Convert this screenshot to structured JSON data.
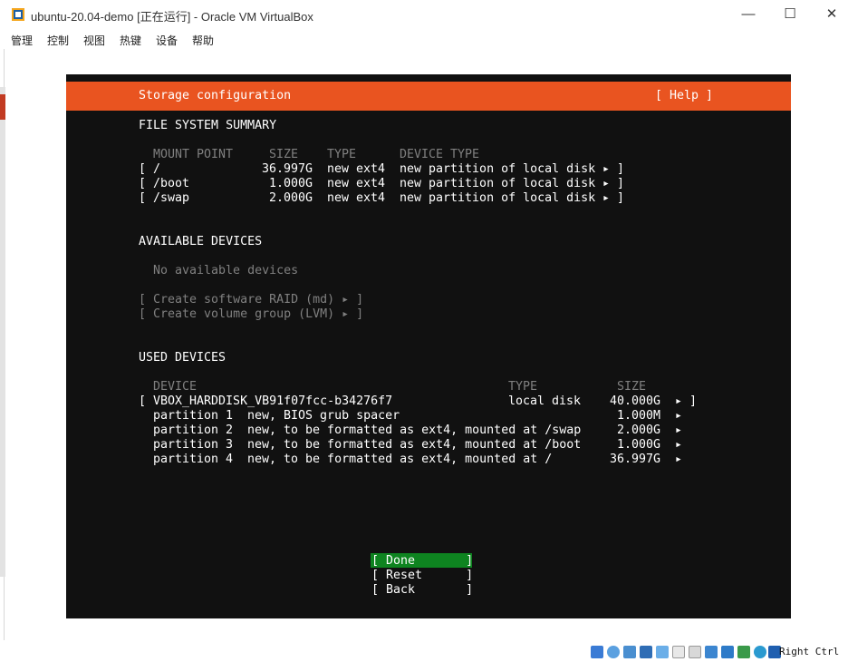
{
  "window": {
    "title": "ubuntu-20.04-demo [正在运行] - Oracle VM VirtualBox",
    "minimize": "—",
    "maximize": "☐",
    "close": "✕"
  },
  "menu": [
    "管理",
    "控制",
    "视图",
    "热键",
    "设备",
    "帮助"
  ],
  "installer": {
    "header_title": "Storage configuration",
    "help": "[ Help ]",
    "fs_summary": {
      "heading": "FILE SYSTEM SUMMARY",
      "columns": [
        "MOUNT POINT",
        "SIZE",
        "TYPE",
        "DEVICE TYPE"
      ],
      "rows": [
        {
          "mount": "/",
          "size": "36.997G",
          "type": "new ext4",
          "device_type": "new partition of local disk"
        },
        {
          "mount": "/boot",
          "size": "1.000G",
          "type": "new ext4",
          "device_type": "new partition of local disk"
        },
        {
          "mount": "/swap",
          "size": "2.000G",
          "type": "new ext4",
          "device_type": "new partition of local disk"
        }
      ]
    },
    "available": {
      "heading": "AVAILABLE DEVICES",
      "none": "No available devices",
      "raid": "[ Create software RAID (md) ▸ ]",
      "lvm": "[ Create volume group (LVM) ▸ ]"
    },
    "used": {
      "heading": "USED DEVICES",
      "columns": [
        "DEVICE",
        "TYPE",
        "SIZE"
      ],
      "disk": {
        "name": "VBOX_HARDDISK_VB91f07fcc-b34276f7",
        "type": "local disk",
        "size": "40.000G"
      },
      "partitions": [
        {
          "name": "partition 1",
          "desc": "new, BIOS grub spacer",
          "size": "1.000M"
        },
        {
          "name": "partition 2",
          "desc": "new, to be formatted as ext4, mounted at /swap",
          "size": "2.000G"
        },
        {
          "name": "partition 3",
          "desc": "new, to be formatted as ext4, mounted at /boot",
          "size": "1.000G"
        },
        {
          "name": "partition 4",
          "desc": "new, to be formatted as ext4, mounted at /",
          "size": "36.997G"
        }
      ]
    },
    "buttons": {
      "done": "[ Done       ]",
      "reset": "[ Reset      ]",
      "back": "[ Back       ]"
    }
  },
  "statusbar": {
    "host_key": "Right Ctrl"
  },
  "colors": {
    "accent": "#e95420",
    "done_button": "#0e8420",
    "console_bg": "#111111"
  }
}
